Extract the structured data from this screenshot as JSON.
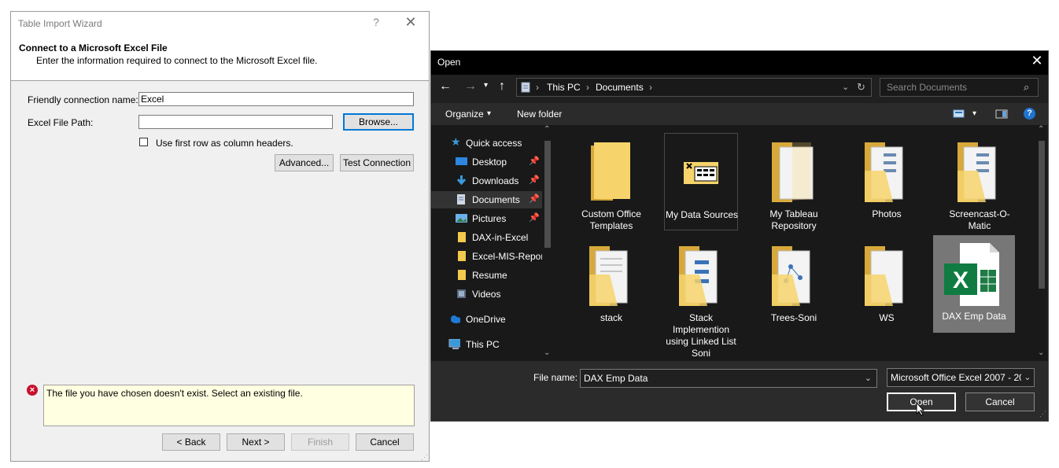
{
  "wizard": {
    "title": "Table Import Wizard",
    "help_glyph": "?",
    "close_glyph": "✕",
    "heading": "Connect to a Microsoft Excel File",
    "subheading": "Enter the information required to connect to the Microsoft Excel file.",
    "friendly_name_label": "Friendly connection name:",
    "friendly_name_value": "Excel",
    "file_path_label": "Excel File Path:",
    "file_path_value": "",
    "browse_label": "Browse...",
    "first_row_label": "Use first row as column headers.",
    "first_row_checked": false,
    "advanced_label": "Advanced...",
    "test_connection_label": "Test Connection",
    "error_message": "The file you have chosen doesn't exist. Select an existing file.",
    "back_label": "< Back",
    "next_label": "Next >",
    "finish_label": "Finish",
    "cancel_label": "Cancel"
  },
  "open_dialog": {
    "title": "Open",
    "close_glyph": "✕",
    "breadcrumb": [
      "This PC",
      "Documents"
    ],
    "search_placeholder": "Search Documents",
    "organize_label": "Organize",
    "new_folder_label": "New folder",
    "nav_items": [
      {
        "label": "Quick access",
        "icon": "star-icon",
        "pinned": false
      },
      {
        "label": "Desktop",
        "icon": "desktop-icon",
        "pinned": true
      },
      {
        "label": "Downloads",
        "icon": "download-arrow-icon",
        "pinned": true
      },
      {
        "label": "Documents",
        "icon": "document-icon",
        "pinned": true,
        "selected": true
      },
      {
        "label": "Pictures",
        "icon": "pictures-icon",
        "pinned": true
      },
      {
        "label": "DAX-in-Excel",
        "icon": "folder-icon",
        "pinned": false
      },
      {
        "label": "Excel-MIS-Repor",
        "icon": "folder-icon",
        "pinned": false
      },
      {
        "label": "Resume",
        "icon": "folder-icon",
        "pinned": false
      },
      {
        "label": "Videos",
        "icon": "videos-icon",
        "pinned": false
      },
      {
        "label": "OneDrive",
        "icon": "cloud-icon",
        "pinned": false
      },
      {
        "label": "This PC",
        "icon": "computer-icon",
        "pinned": false
      }
    ],
    "files": [
      {
        "label": "Custom Office Templates",
        "type": "folder"
      },
      {
        "label": "My Data Sources",
        "type": "datasource"
      },
      {
        "label": "My Tableau Repository",
        "type": "folder-doc"
      },
      {
        "label": "Photos",
        "type": "folder-doc"
      },
      {
        "label": "Screencast-O-Matic",
        "type": "folder-doc"
      },
      {
        "label": "stack",
        "type": "folder-doc"
      },
      {
        "label": "Stack Implemention using Linked List Soni",
        "type": "folder-doc"
      },
      {
        "label": "Trees-Soni",
        "type": "folder-doc"
      },
      {
        "label": "WS",
        "type": "folder-doc"
      },
      {
        "label": "DAX Emp Data",
        "type": "excel",
        "selected": true
      }
    ],
    "file_name_label": "File name:",
    "file_name_value": "DAX Emp Data",
    "file_type_value": "Microsoft Office Excel 2007 - 20",
    "open_label": "Open",
    "cancel_label": "Cancel"
  }
}
